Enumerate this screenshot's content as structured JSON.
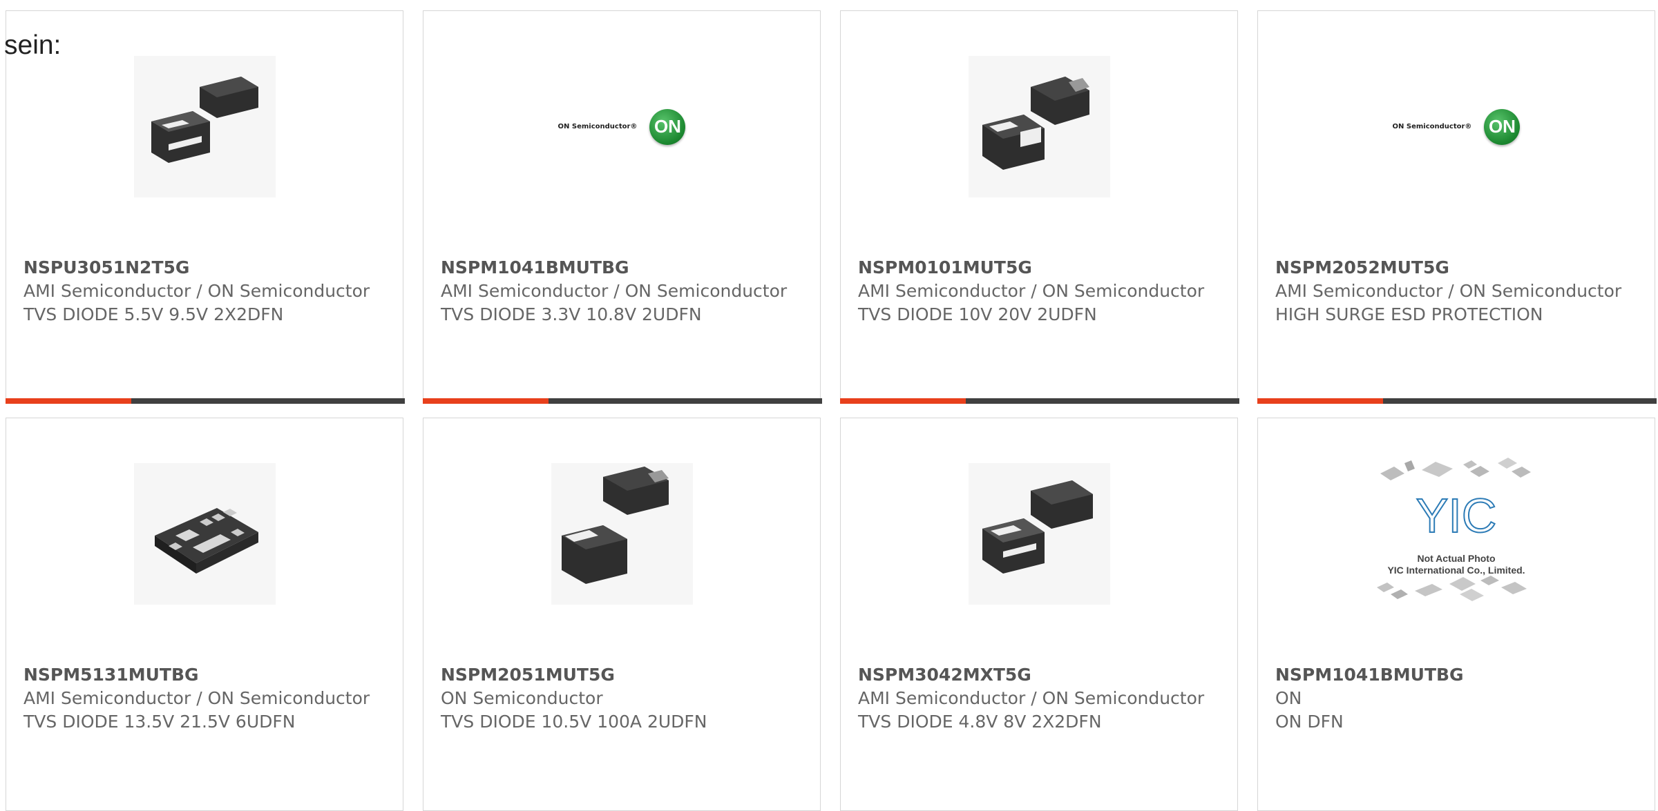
{
  "intro_text": "sein:",
  "products": [
    {
      "part": "NSPU3051N2T5G",
      "manufacturer": "AMI Semiconductor / ON Semiconductor",
      "description": "TVS DIODE 5.5V 9.5V 2X2DFN",
      "image": "two-chip-package"
    },
    {
      "part": "NSPM1041BMUTBG",
      "manufacturer": "AMI Semiconductor / ON Semiconductor",
      "description": "TVS DIODE 3.3V 10.8V 2UDFN",
      "image": "on-semiconductor-logo"
    },
    {
      "part": "NSPM0101MUT5G",
      "manufacturer": "AMI Semiconductor / ON Semiconductor",
      "description": "TVS DIODE 10V 20V 2UDFN",
      "image": "two-chip-package"
    },
    {
      "part": "NSPM2052MUT5G",
      "manufacturer": "AMI Semiconductor / ON Semiconductor",
      "description": "HIGH SURGE ESD PROTECTION",
      "image": "on-semiconductor-logo"
    },
    {
      "part": "NSPM5131MUTBG",
      "manufacturer": "AMI Semiconductor / ON Semiconductor",
      "description": "TVS DIODE 13.5V 21.5V 6UDFN",
      "image": "six-pad-package"
    },
    {
      "part": "NSPM2051MUT5G",
      "manufacturer": "ON Semiconductor",
      "description": "TVS DIODE 10.5V 100A 2UDFN",
      "image": "two-chip-package"
    },
    {
      "part": "NSPM3042MXT5G",
      "manufacturer": "AMI Semiconductor / ON Semiconductor",
      "description": "TVS DIODE 4.8V 8V 2X2DFN",
      "image": "two-chip-package"
    },
    {
      "part": "NSPM1041BMUTBG",
      "manufacturer": "ON",
      "description": "ON DFN",
      "image": "yic-not-actual-photo"
    }
  ],
  "logo": {
    "on_text": "ON Semiconductor®",
    "on_badge": "ON"
  },
  "yic": {
    "brand": "YIC",
    "line1": "Not Actual Photo",
    "line2": "YIC International Co., Limited."
  },
  "colors": {
    "accent": "#e8401c",
    "bar": "#404040",
    "border": "#d6d6d6",
    "on_green": "#2a9a3e"
  }
}
